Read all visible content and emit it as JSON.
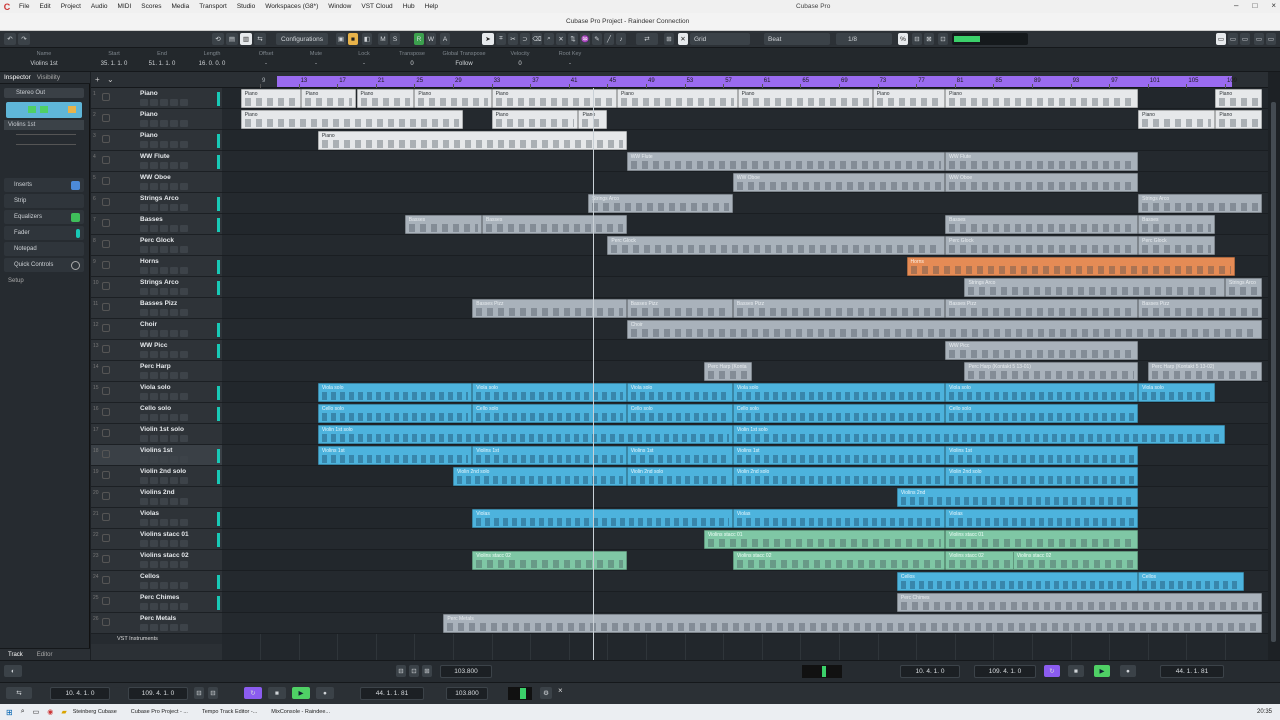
{
  "menubar": {
    "items": [
      "File",
      "Edit",
      "Project",
      "Audio",
      "MIDI",
      "Scores",
      "Media",
      "Transport",
      "Studio",
      "Workspaces (G8*)",
      "Window",
      "VST Cloud",
      "Hub",
      "Help"
    ],
    "app_title": "Cubase Pro"
  },
  "titlebar": {
    "title": "Cubase Pro Project - Raindeer Connection"
  },
  "toolbar": {
    "configurations": "Configurations",
    "grid_label": "Grid",
    "beat_label": "Beat",
    "quantize_label": "1/8"
  },
  "infoline": {
    "columns": [
      {
        "label": "Name",
        "value": "Violins 1st"
      },
      {
        "label": "Start",
        "value": "35. 1. 1.  0"
      },
      {
        "label": "End",
        "value": "51. 1. 1.  0"
      },
      {
        "label": "Length",
        "value": "16. 0. 0.  0"
      },
      {
        "label": "Offset",
        "value": "-"
      },
      {
        "label": "Mute",
        "value": "-"
      },
      {
        "label": "Lock",
        "value": "-"
      },
      {
        "label": "Transpose",
        "value": "0"
      },
      {
        "label": "Global Transpose",
        "value": "Follow"
      },
      {
        "label": "Velocity",
        "value": "0"
      },
      {
        "label": "Root Key",
        "value": "-"
      }
    ]
  },
  "inspector": {
    "tabs": [
      "Inspector",
      "Visibility"
    ],
    "track_name": "Violins 1st",
    "output": "Stereo Out",
    "sections": [
      "Inserts",
      "Strip",
      "Equalizers",
      "Fader",
      "Notepad",
      "Quick Controls"
    ],
    "setup": "Setup",
    "bottom_tabs": [
      "Track",
      "Editor"
    ]
  },
  "ruler": {
    "bars": [
      "9",
      "13",
      "17",
      "21",
      "25",
      "29",
      "33",
      "37",
      "41",
      "45",
      "49",
      "53",
      "57",
      "61",
      "65",
      "69",
      "73",
      "77",
      "81",
      "85",
      "89",
      "93",
      "97",
      "101",
      "105",
      "109"
    ]
  },
  "tracks": [
    {
      "num": "1",
      "name": "Piano"
    },
    {
      "num": "2",
      "name": "Piano"
    },
    {
      "num": "3",
      "name": "Piano"
    },
    {
      "num": "4",
      "name": "WW Flute"
    },
    {
      "num": "5",
      "name": "WW Oboe"
    },
    {
      "num": "6",
      "name": "Strings Arco"
    },
    {
      "num": "7",
      "name": "Basses"
    },
    {
      "num": "8",
      "name": "Perc Glock"
    },
    {
      "num": "9",
      "name": "Horns"
    },
    {
      "num": "10",
      "name": "Strings Arco"
    },
    {
      "num": "11",
      "name": "Basses Pizz"
    },
    {
      "num": "12",
      "name": "Choir"
    },
    {
      "num": "13",
      "name": "WW Picc"
    },
    {
      "num": "14",
      "name": "Perc Harp"
    },
    {
      "num": "15",
      "name": "Viola solo"
    },
    {
      "num": "16",
      "name": "Cello solo"
    },
    {
      "num": "17",
      "name": "Violin 1st solo"
    },
    {
      "num": "18",
      "name": "Violins 1st"
    },
    {
      "num": "19",
      "name": "Violin 2nd solo"
    },
    {
      "num": "20",
      "name": "Violins 2nd"
    },
    {
      "num": "21",
      "name": "Violas"
    },
    {
      "num": "22",
      "name": "Violins stacc 01"
    },
    {
      "num": "23",
      "name": "Violins stacc 02"
    },
    {
      "num": "24",
      "name": "Cellos"
    },
    {
      "num": "25",
      "name": "Perc Chimes"
    },
    {
      "num": "26",
      "name": "Perc Metals"
    }
  ],
  "folder_label": "VST Instruments",
  "parts": [
    {
      "row": 0,
      "start": 7,
      "end": 13.3,
      "label": "Piano",
      "color": "white"
    },
    {
      "row": 0,
      "start": 13.3,
      "end": 19,
      "label": "Piano",
      "color": "white"
    },
    {
      "row": 0,
      "start": 19,
      "end": 25,
      "label": "Piano",
      "color": "white"
    },
    {
      "row": 0,
      "start": 25,
      "end": 33,
      "label": "Piano",
      "color": "white"
    },
    {
      "row": 0,
      "start": 33,
      "end": 46,
      "label": "Piano",
      "color": "white"
    },
    {
      "row": 0,
      "start": 46,
      "end": 58.5,
      "label": "Piano",
      "color": "white"
    },
    {
      "row": 0,
      "start": 58.5,
      "end": 72.5,
      "label": "Piano",
      "color": "white"
    },
    {
      "row": 0,
      "start": 72.5,
      "end": 80,
      "label": "Piano",
      "color": "white"
    },
    {
      "row": 0,
      "start": 80,
      "end": 100,
      "label": "Piano",
      "color": "white"
    },
    {
      "row": 0,
      "start": 108,
      "end": 116,
      "label": "Piano",
      "color": "white"
    },
    {
      "row": 1,
      "start": 7,
      "end": 30,
      "label": "Piano",
      "color": "white"
    },
    {
      "row": 1,
      "start": 33,
      "end": 42,
      "label": "Piano",
      "color": "white"
    },
    {
      "row": 1,
      "start": 42,
      "end": 45,
      "label": "Piano",
      "color": "white"
    },
    {
      "row": 1,
      "start": 100,
      "end": 108,
      "label": "Piano",
      "color": "white"
    },
    {
      "row": 1,
      "start": 108,
      "end": 116,
      "label": "Piano",
      "color": "white"
    },
    {
      "row": 2,
      "start": 15,
      "end": 47,
      "label": "Piano",
      "color": "white"
    },
    {
      "row": 3,
      "start": 47,
      "end": 80,
      "label": "WW Flute",
      "color": "grey"
    },
    {
      "row": 3,
      "start": 80,
      "end": 100,
      "label": "WW Flute",
      "color": "grey"
    },
    {
      "row": 4,
      "start": 58,
      "end": 80,
      "label": "WW Oboe",
      "color": "grey"
    },
    {
      "row": 4,
      "start": 80,
      "end": 100,
      "label": "WW Oboe",
      "color": "grey"
    },
    {
      "row": 5,
      "start": 43,
      "end": 58,
      "label": "Strings Arco",
      "color": "grey"
    },
    {
      "row": 5,
      "start": 100,
      "end": 117,
      "label": "Strings Arco",
      "color": "grey"
    },
    {
      "row": 6,
      "start": 24,
      "end": 32,
      "label": "Basses",
      "color": "grey"
    },
    {
      "row": 6,
      "start": 32,
      "end": 47,
      "label": "Basses",
      "color": "grey"
    },
    {
      "row": 6,
      "start": 80,
      "end": 100,
      "label": "Basses",
      "color": "grey"
    },
    {
      "row": 6,
      "start": 100,
      "end": 108,
      "label": "Basses",
      "color": "grey"
    },
    {
      "row": 7,
      "start": 45,
      "end": 80,
      "label": "Perc Glock",
      "color": "grey"
    },
    {
      "row": 7,
      "start": 80,
      "end": 100,
      "label": "Perc Glock",
      "color": "grey"
    },
    {
      "row": 7,
      "start": 100,
      "end": 108,
      "label": "Perc Glock",
      "color": "grey"
    },
    {
      "row": 8,
      "start": 76,
      "end": 110,
      "label": "Horns",
      "color": "orange"
    },
    {
      "row": 9,
      "start": 82,
      "end": 109,
      "label": "Strings Arco",
      "color": "grey"
    },
    {
      "row": 9,
      "start": 109,
      "end": 118,
      "label": "Strings Arco",
      "color": "grey"
    },
    {
      "row": 10,
      "start": 31,
      "end": 47,
      "label": "Basses Pizz",
      "color": "grey"
    },
    {
      "row": 10,
      "start": 47,
      "end": 58,
      "label": "Basses Pizz",
      "color": "grey"
    },
    {
      "row": 10,
      "start": 58,
      "end": 80,
      "label": "Basses Pizz",
      "color": "grey"
    },
    {
      "row": 10,
      "start": 80,
      "end": 100,
      "label": "Basses Pizz",
      "color": "grey"
    },
    {
      "row": 10,
      "start": 100,
      "end": 117,
      "label": "Basses Pizz",
      "color": "grey"
    },
    {
      "row": 11,
      "start": 47,
      "end": 117,
      "label": "Choir",
      "color": "grey"
    },
    {
      "row": 12,
      "start": 80,
      "end": 100,
      "label": "WW Picc",
      "color": "grey"
    },
    {
      "row": 13,
      "start": 55,
      "end": 60,
      "label": "Perc Harp (Konta",
      "color": "grey"
    },
    {
      "row": 13,
      "start": 82,
      "end": 100,
      "label": "Perc Harp (Kontakt 5 13-01)",
      "color": "grey"
    },
    {
      "row": 13,
      "start": 101,
      "end": 113,
      "label": "Perc Harp (Kontakt 5 13-02)",
      "color": "grey"
    },
    {
      "row": 14,
      "start": 15,
      "end": 31,
      "label": "Viola solo",
      "color": "blue"
    },
    {
      "row": 14,
      "start": 31,
      "end": 47,
      "label": "Viola solo",
      "color": "blue"
    },
    {
      "row": 14,
      "start": 47,
      "end": 58,
      "label": "Viola solo",
      "color": "blue"
    },
    {
      "row": 14,
      "start": 58,
      "end": 80,
      "label": "Viola solo",
      "color": "blue"
    },
    {
      "row": 14,
      "start": 80,
      "end": 100,
      "label": "Viola solo",
      "color": "blue"
    },
    {
      "row": 14,
      "start": 100,
      "end": 108,
      "label": "Viola solo",
      "color": "blue"
    },
    {
      "row": 15,
      "start": 15,
      "end": 31,
      "label": "Cello solo",
      "color": "blue"
    },
    {
      "row": 15,
      "start": 31,
      "end": 47,
      "label": "Cello solo",
      "color": "blue"
    },
    {
      "row": 15,
      "start": 47,
      "end": 58,
      "label": "Cello solo",
      "color": "blue"
    },
    {
      "row": 15,
      "start": 58,
      "end": 80,
      "label": "Cello solo",
      "color": "blue"
    },
    {
      "row": 15,
      "start": 80,
      "end": 100,
      "label": "Cello solo",
      "color": "blue"
    },
    {
      "row": 16,
      "start": 15,
      "end": 58,
      "label": "Violin 1st solo",
      "color": "blue"
    },
    {
      "row": 16,
      "start": 58,
      "end": 109,
      "label": "Violin 1st solo",
      "color": "blue"
    },
    {
      "row": 17,
      "start": 15,
      "end": 31,
      "label": "Violins 1st",
      "color": "blue"
    },
    {
      "row": 17,
      "start": 31,
      "end": 47,
      "label": "Violins 1st",
      "color": "blue"
    },
    {
      "row": 17,
      "start": 47,
      "end": 58,
      "label": "Violins 1st",
      "color": "blue"
    },
    {
      "row": 17,
      "start": 58,
      "end": 80,
      "label": "Violins 1st",
      "color": "blue"
    },
    {
      "row": 17,
      "start": 80,
      "end": 100,
      "label": "Violins 1st",
      "color": "blue"
    },
    {
      "row": 18,
      "start": 29,
      "end": 47,
      "label": "Violin 2nd solo",
      "color": "blue"
    },
    {
      "row": 18,
      "start": 47,
      "end": 58,
      "label": "Violin 2nd solo",
      "color": "blue"
    },
    {
      "row": 18,
      "start": 58,
      "end": 80,
      "label": "Violin 2nd solo",
      "color": "blue"
    },
    {
      "row": 18,
      "start": 80,
      "end": 100,
      "label": "Violin 2nd solo",
      "color": "blue"
    },
    {
      "row": 19,
      "start": 75,
      "end": 100,
      "label": "Violins 2nd",
      "color": "blue"
    },
    {
      "row": 20,
      "start": 31,
      "end": 58,
      "label": "Violas",
      "color": "blue"
    },
    {
      "row": 20,
      "start": 58,
      "end": 80,
      "label": "Violas",
      "color": "blue"
    },
    {
      "row": 20,
      "start": 80,
      "end": 100,
      "label": "Violas",
      "color": "blue"
    },
    {
      "row": 21,
      "start": 55,
      "end": 80,
      "label": "Violins stacc 01",
      "color": "green"
    },
    {
      "row": 21,
      "start": 80,
      "end": 100,
      "label": "Violins stacc 01",
      "color": "green"
    },
    {
      "row": 22,
      "start": 31,
      "end": 47,
      "label": "Violins stacc 02",
      "color": "green"
    },
    {
      "row": 22,
      "start": 58,
      "end": 80,
      "label": "Violins stacc 02",
      "color": "green"
    },
    {
      "row": 22,
      "start": 80,
      "end": 100,
      "label": "Violins stacc 02",
      "color": "green"
    },
    {
      "row": 22,
      "start": 87,
      "end": 100,
      "label": "Violins stacc 02",
      "color": "green"
    },
    {
      "row": 23,
      "start": 75,
      "end": 100,
      "label": "Cellos",
      "color": "blue"
    },
    {
      "row": 23,
      "start": 100,
      "end": 111,
      "label": "Cellos",
      "color": "blue"
    },
    {
      "row": 24,
      "start": 75,
      "end": 117,
      "label": "Perc Chimes",
      "color": "grey"
    },
    {
      "row": 25,
      "start": 28,
      "end": 117,
      "label": "Perc Metals",
      "color": "grey"
    }
  ],
  "bottom_panel": {
    "tempo": "103.800",
    "left_locator": "10. 4. 1.  0",
    "right_locator": "109. 4. 1.  0",
    "position": "44. 1. 1. 81"
  },
  "transport": {
    "left_locator": "10. 4. 1.  0",
    "right_locator": "109. 4. 1.  0",
    "position": "44. 1. 1. 81",
    "tempo": "103.800"
  },
  "taskbar": {
    "items": [
      "Steinberg Cubase",
      "Cubase Pro Project - ...",
      "Tempo Track Editor -...",
      "MixConsole - Raindee..."
    ],
    "clock": "20:35"
  },
  "colors": {
    "loop_bar": "#9a6bf0",
    "part_blue": "#4db3dd",
    "part_grey": "#a9b2bb",
    "part_green": "#7fc7a5",
    "part_orange": "#e58b55",
    "meter": "#18c9b6"
  }
}
